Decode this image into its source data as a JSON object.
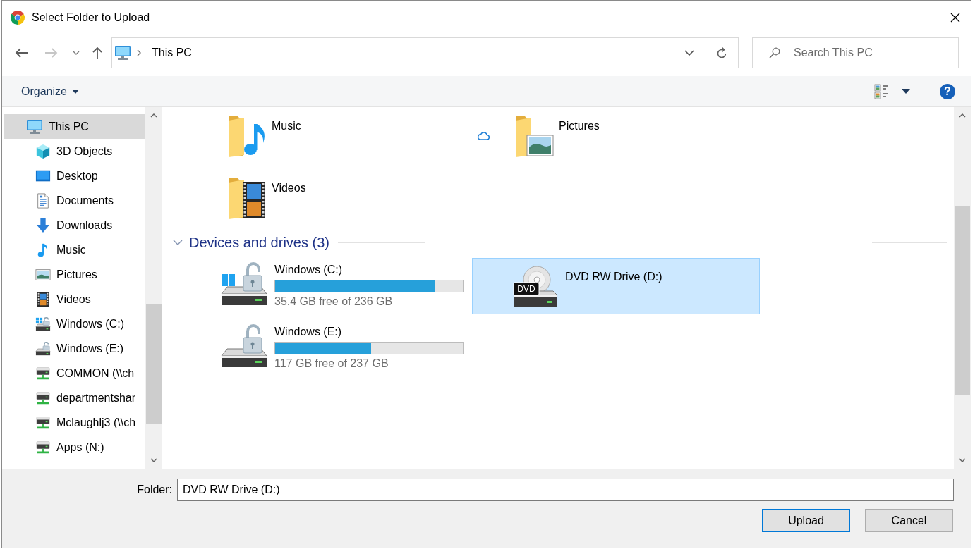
{
  "window": {
    "title": "Select Folder to Upload"
  },
  "navigation": {
    "back": {
      "disabled": false
    },
    "forward": {
      "disabled": true
    }
  },
  "address_bar": {
    "breadcrumbs": [
      "This PC"
    ]
  },
  "search": {
    "placeholder": "Search This PC"
  },
  "toolbar": {
    "organize": "Organize",
    "help": "?"
  },
  "sidebar": {
    "items": [
      {
        "label": "This PC",
        "kind": "pc",
        "selected": true,
        "children": [
          {
            "label": "3D Objects",
            "kind": "objects",
            "selected": false
          },
          {
            "label": "Desktop",
            "kind": "desktop",
            "selected": false
          },
          {
            "label": "Documents",
            "kind": "documents",
            "selected": false
          },
          {
            "label": "Downloads",
            "kind": "downloads",
            "selected": false
          },
          {
            "label": "Music",
            "kind": "music",
            "selected": false
          },
          {
            "label": "Pictures",
            "kind": "pictures",
            "selected": false
          },
          {
            "label": "Videos",
            "kind": "videos",
            "selected": false
          },
          {
            "label": "Windows (C:)",
            "kind": "windows-drive",
            "selected": false
          },
          {
            "label": "Windows (E:)",
            "kind": "locked-drive",
            "selected": false
          },
          {
            "label": "COMMON (\\\\ch",
            "kind": "network-drive",
            "selected": false
          },
          {
            "label": "departmentshar",
            "kind": "network-drive",
            "selected": false
          },
          {
            "label": "Mclaughlj3 (\\\\ch",
            "kind": "network-drive",
            "selected": false
          },
          {
            "label": "Apps (N:)",
            "kind": "network-drive",
            "selected": false
          }
        ]
      }
    ]
  },
  "content": {
    "folders": [
      {
        "name": "Music",
        "kind": "music",
        "cloud": false,
        "selected": false
      },
      {
        "name": "Pictures",
        "kind": "pictures",
        "cloud": true,
        "selected": false
      },
      {
        "name": "Videos",
        "kind": "videos",
        "cloud": false,
        "selected": false
      }
    ],
    "drives": {
      "title": "Devices and drives (3)",
      "expanded": true,
      "items": [
        {
          "name": "Windows (C:)",
          "kind": "windows",
          "level": 0.85,
          "free_space": "35.4 GB free of 236 GB",
          "selected": false
        },
        {
          "name": "DVD RW Drive (D:)",
          "kind": "dvd",
          "disc_label": "DVD",
          "selected": true
        },
        {
          "name": "Windows (E:)",
          "kind": "locked",
          "level": 0.51,
          "free_space": "117 GB free of 237 GB",
          "selected": false
        }
      ]
    }
  },
  "footer": {
    "folder_label": "Folder:",
    "folder_value": "DVD RW Drive (D:)",
    "buttons": [
      {
        "label": "Upload",
        "default": true
      },
      {
        "label": "Cancel",
        "default": false
      }
    ]
  }
}
